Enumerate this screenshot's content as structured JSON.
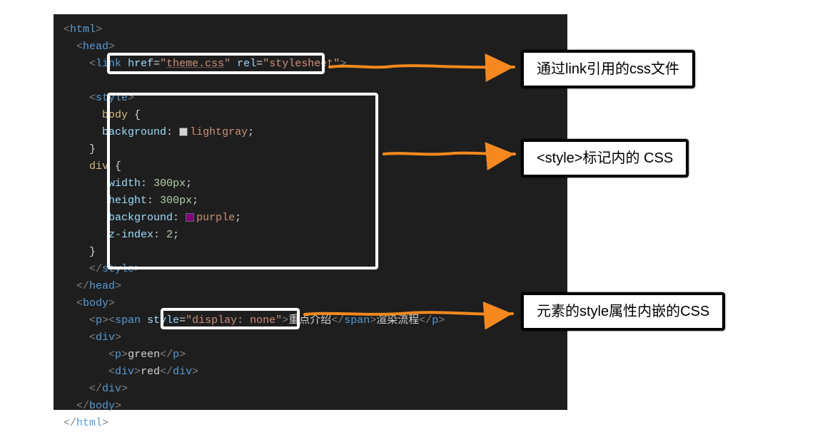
{
  "code": {
    "html_open": "<html>",
    "head_open": "<head>",
    "link_tag": "<link href=\"theme.css\" rel=\"stylesheet\">",
    "style_open": "<style>",
    "body_sel": "body {",
    "bg_lightgray": "background: lightgray;",
    "close_brace": "}",
    "div_sel": "div {",
    "width": "width: 300px;",
    "height": "height: 300px;",
    "bg_purple": "background: purple;",
    "zindex": "z-index: 2;",
    "style_close": "</style>",
    "head_close": "</head>",
    "body_open": "<body>",
    "p_span_line": "<p><span style=\"display: none\">重点介绍</span>渲染流程</p>",
    "div_open": "<div>",
    "p_green": "<p>green</p>",
    "div_red": "<div>red</div>",
    "div_close": "</div>",
    "body_close": "</body>",
    "html_close": "</html>"
  },
  "labels": {
    "link_label": "通过link引用的css文件",
    "style_label": "<style>标记内的 CSS",
    "inline_label": "元素的style属性内嵌的CSS"
  },
  "colors": {
    "arrow": "#f5891f",
    "editor_bg": "#1e1e1e",
    "tag": "#569cd6",
    "attr": "#9cdcfe",
    "string": "#ce9178",
    "selector": "#d7ba7d",
    "number": "#b5cea8"
  }
}
